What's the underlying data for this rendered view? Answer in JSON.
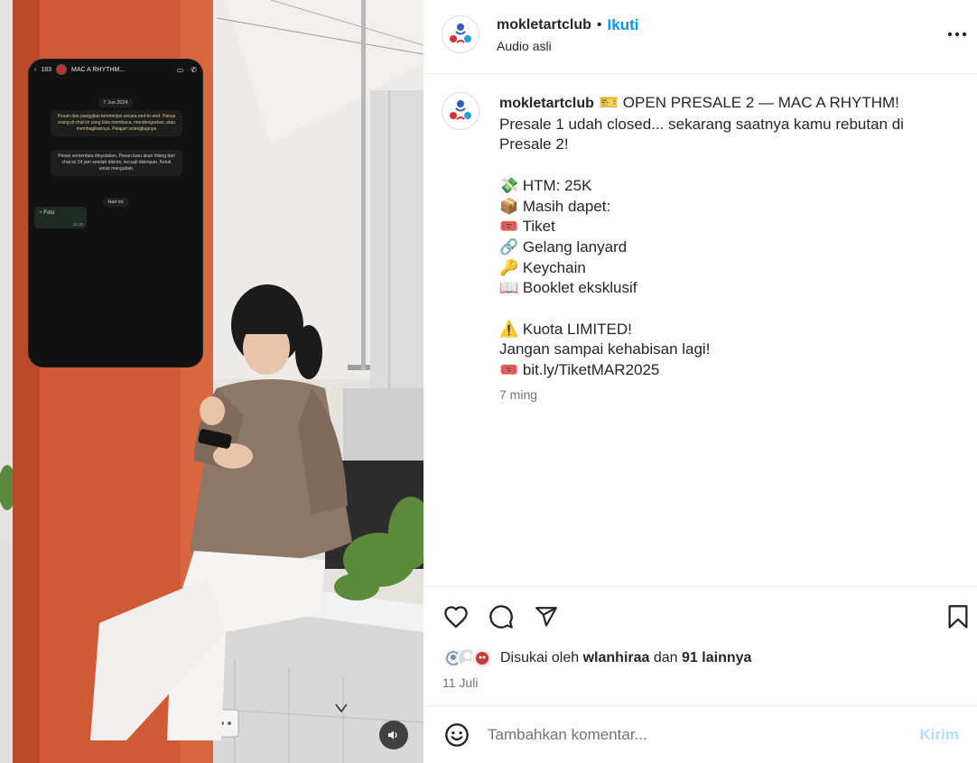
{
  "media": {
    "phone": {
      "back_count": "183",
      "chat_title": "MAC A RHYTHM...",
      "date_chip": "7 Jun 2024",
      "encryption_msg": "Pesan dan panggilan terenkripsi secara end-to-end. Hanya orang di chat ini yang bisa membaca, mendengarkan, atau membagikannya. Pelajari selengkapnya",
      "disappearing_msg": "Pesan sementara dinyalakan. Pesan baru akan hilang dari chat ini 24 jam setelah dikirim, kecuali disimpan. Ketuk untuk mengubah.",
      "today_chip": "Hari ini",
      "bubble_label": "Foto",
      "bubble_time": "16.20"
    },
    "mute_icon": "speaker-icon"
  },
  "header": {
    "username": "mokletartclub",
    "separator": "•",
    "follow_label": "Ikuti",
    "audio_label": "Audio asli",
    "more_icon": "more-horizontal-icon"
  },
  "caption": {
    "username": "mokletartclub",
    "lines": [
      "🎫 OPEN PRESALE 2 — MAC A RHYTHM!",
      "Presale 1 udah closed... sekarang saatnya kamu rebutan di Presale 2!",
      "",
      "💸 HTM: 25K",
      "📦 Masih dapet:",
      "🎟️ Tiket",
      "🔗 Gelang lanyard",
      "🔑 Keychain",
      "📖 Booklet eksklusif",
      "",
      "⚠️ Kuota LIMITED!",
      "Jangan sampai kehabisan lagi!",
      "🎟️ bit.ly/TiketMAR2025"
    ],
    "time_ago": "7 ming"
  },
  "actions": {
    "like_icon": "heart-icon",
    "comment_icon": "comment-icon",
    "share_icon": "send-icon",
    "save_icon": "bookmark-icon"
  },
  "likes": {
    "prefix": "Disukai oleh",
    "user": "wlanhiraa",
    "joiner": "dan",
    "others": "91 lainnya"
  },
  "post_date": "11 Juli",
  "comment": {
    "placeholder": "Tambahkan komentar...",
    "send_label": "Kirim",
    "emoji_icon": "smiley-icon"
  },
  "colors": {
    "accent": "#0095f6",
    "send_disabled": "#b2dffc",
    "secondary_text": "#737373",
    "primary_text": "#262626"
  }
}
